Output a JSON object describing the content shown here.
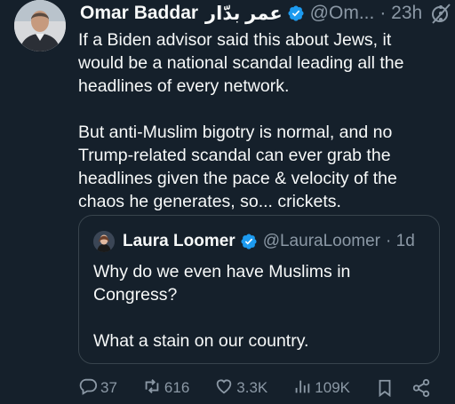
{
  "tweet": {
    "author": {
      "name": "Omar Baddar",
      "name_ar": "عمر بدّار",
      "handle": "@Om...",
      "time": "· 23h"
    },
    "paragraphs": [
      "If a Biden advisor said this about Jews, it would be a national scandal leading all the headlines of every network.",
      "But anti-Muslim bigotry is normal, and no Trump-related scandal can ever grab the headlines given the pace & velocity of the chaos he generates, so... crickets."
    ],
    "quote": {
      "author": {
        "name": "Laura Loomer",
        "handle": "@LauraLoomer",
        "time": "· 1d"
      },
      "paragraphs": [
        "Why do we even have Muslims in Congress?",
        "What a stain on our country."
      ]
    },
    "actions": {
      "replies": "37",
      "reposts": "616",
      "likes": "3.3K",
      "views": "109K"
    }
  },
  "colors": {
    "background": "#15202b",
    "text": "#f7f9f9",
    "secondary": "#8b98a5",
    "verified": "#1d9bf0",
    "border": "#38444d"
  },
  "icons": [
    "verified-badge-icon",
    "grok-icon",
    "more-icon",
    "reply-icon",
    "repost-icon",
    "like-icon",
    "views-icon",
    "bookmark-icon",
    "share-icon"
  ]
}
